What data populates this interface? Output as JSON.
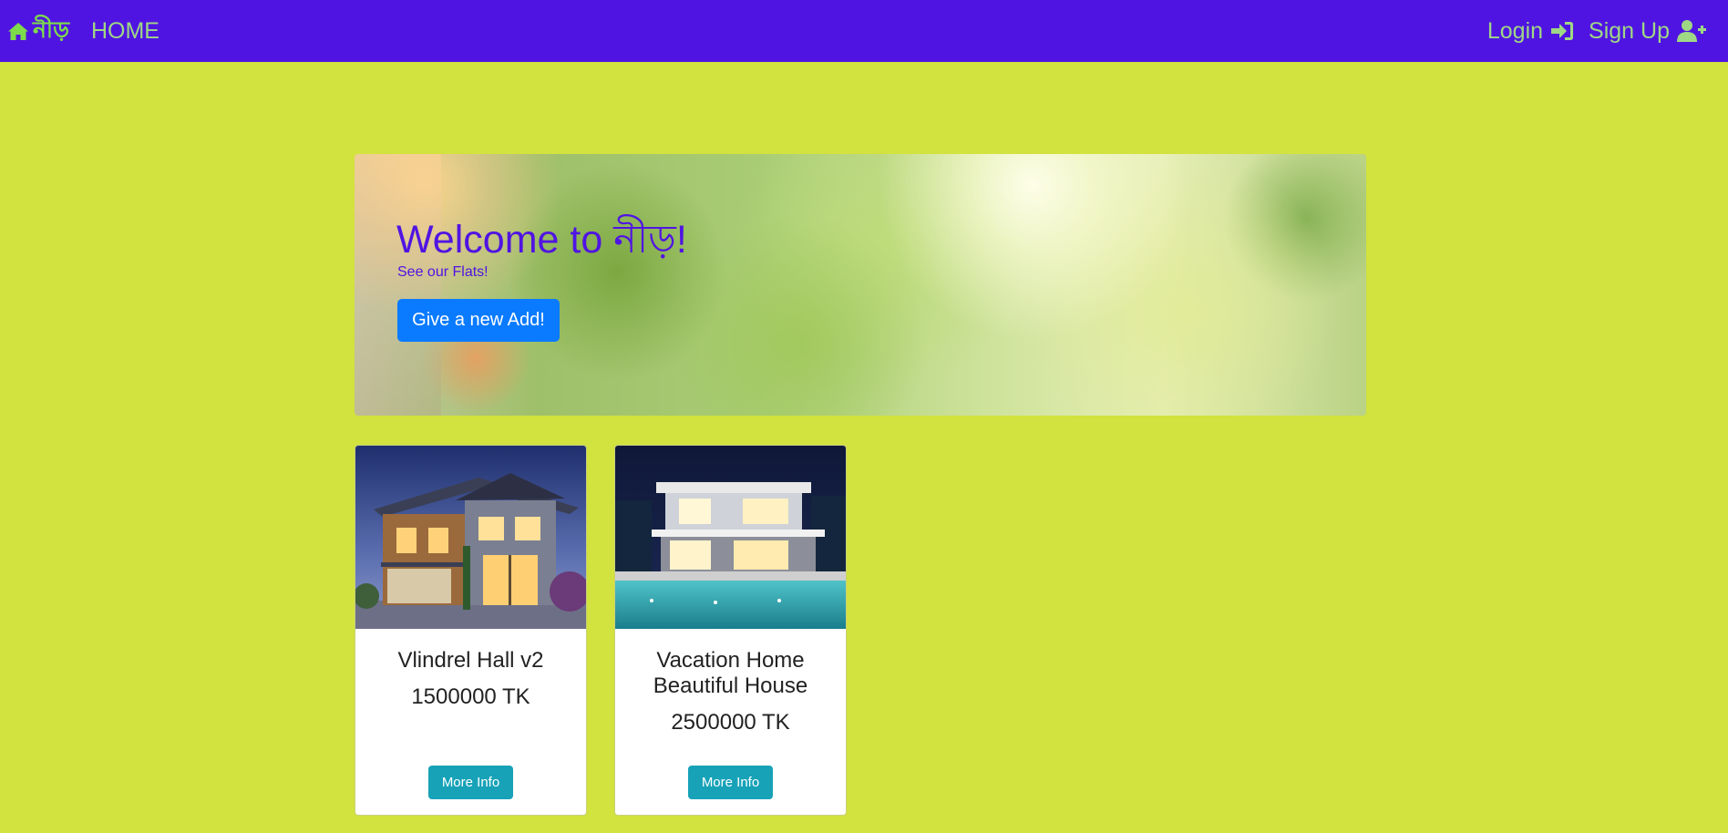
{
  "navbar": {
    "brand_label": "নীড়",
    "home_label": "HOME",
    "login_label": "Login",
    "signup_label": "Sign Up",
    "brand_icon": "home-icon",
    "login_icon": "sign-in-icon",
    "signup_icon": "user-plus-icon",
    "bg_color": "#5014e2",
    "link_color": "#9fd884"
  },
  "hero": {
    "title": "Welcome to নীড়!",
    "subtitle": "See our Flats!",
    "button_label": "Give a new Add!",
    "button_color": "#0a7bff"
  },
  "listings": [
    {
      "title": "Vlindrel Hall v2",
      "price": "1500000 TK",
      "button_label": "More Info"
    },
    {
      "title": "Vacation Home Beautiful House",
      "price": "2500000 TK",
      "button_label": "More Info"
    }
  ],
  "page": {
    "bg_color": "#d2e23e",
    "accent": "#17a2b8"
  }
}
